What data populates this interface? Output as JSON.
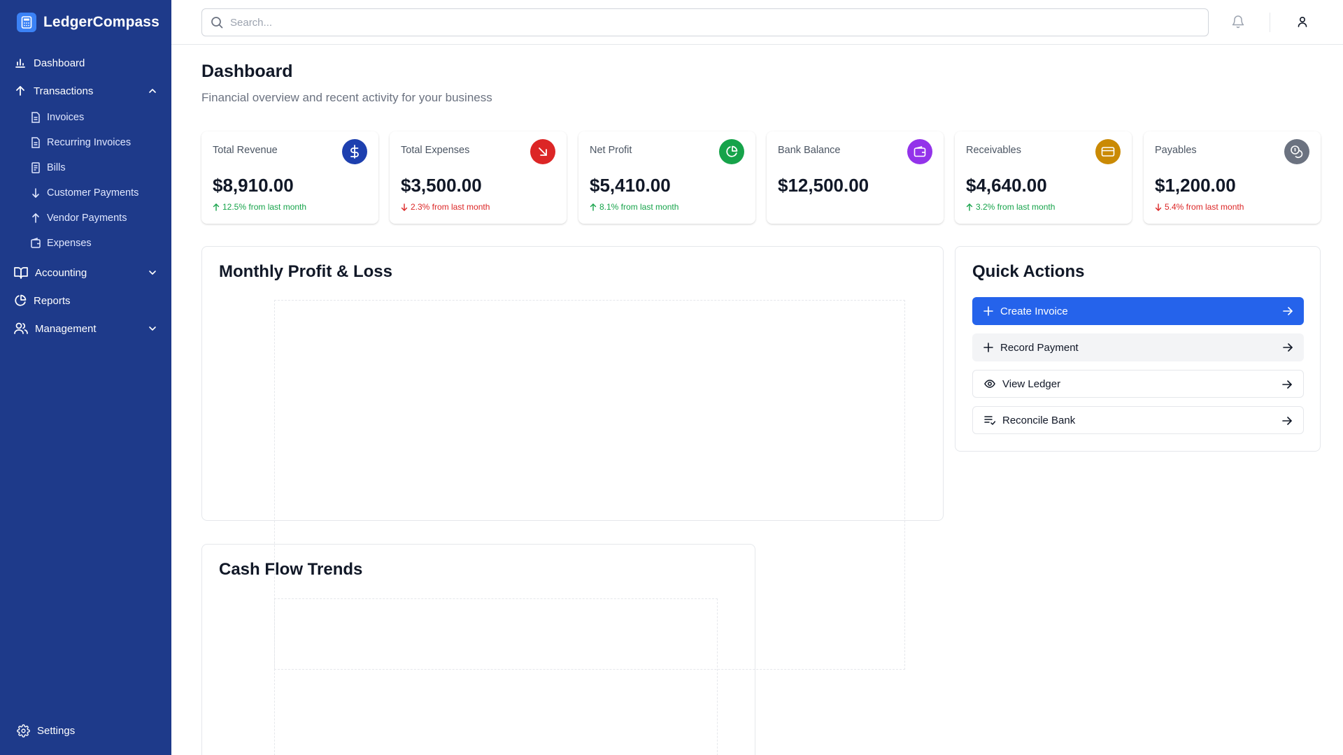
{
  "app": {
    "name": "LedgerCompass"
  },
  "sidebar": {
    "items": [
      {
        "label": "Dashboard",
        "icon": "bar-chart-icon"
      },
      {
        "label": "Transactions",
        "icon": "arrow-up-icon",
        "expanded": true
      },
      {
        "label": "Accounting",
        "icon": "book-icon",
        "expanded": false
      },
      {
        "label": "Reports",
        "icon": "pie-chart-icon"
      },
      {
        "label": "Management",
        "icon": "users-icon",
        "expanded": false
      }
    ],
    "transactions_sub": [
      {
        "label": "Invoices",
        "icon": "file-icon"
      },
      {
        "label": "Recurring Invoices",
        "icon": "file-icon"
      },
      {
        "label": "Bills",
        "icon": "receipt-icon"
      },
      {
        "label": "Customer Payments",
        "icon": "arrow-down-icon"
      },
      {
        "label": "Vendor Payments",
        "icon": "arrow-up-icon"
      },
      {
        "label": "Expenses",
        "icon": "wallet-icon"
      }
    ],
    "settings_label": "Settings"
  },
  "topbar": {
    "search_placeholder": "Search..."
  },
  "page": {
    "title": "Dashboard",
    "subtitle": "Financial overview and recent activity for your business"
  },
  "cards": [
    {
      "label": "Total Revenue",
      "value": "$8,910.00",
      "change": "12.5% from last month",
      "trend": "up",
      "icon": "dollar-icon",
      "color": "#1e40af"
    },
    {
      "label": "Total Expenses",
      "value": "$3,500.00",
      "change": "2.3% from last month",
      "trend": "down",
      "icon": "arrow-down-right-icon",
      "color": "#dc2626"
    },
    {
      "label": "Net Profit",
      "value": "$5,410.00",
      "change": "8.1% from last month",
      "trend": "up",
      "icon": "pie-chart-icon",
      "color": "#16a34a"
    },
    {
      "label": "Bank Balance",
      "value": "$12,500.00",
      "change": "",
      "icon": "wallet-icon",
      "color": "#9333ea"
    },
    {
      "label": "Receivables",
      "value": "$4,640.00",
      "change": "3.2% from last month",
      "trend": "up",
      "icon": "credit-card-icon",
      "color": "#ca8a04"
    },
    {
      "label": "Payables",
      "value": "$1,200.00",
      "change": "5.4% from last month",
      "trend": "down",
      "icon": "coins-icon",
      "color": "#6b7280"
    }
  ],
  "panels": {
    "pl_title": "Monthly Profit & Loss",
    "cashflow_title": "Cash Flow Trends",
    "quick_actions_title": "Quick Actions"
  },
  "quick_actions": [
    {
      "label": "Create Invoice",
      "icon": "plus-icon"
    },
    {
      "label": "Record Payment",
      "icon": "plus-icon"
    },
    {
      "label": "View Ledger",
      "icon": "eye-icon"
    },
    {
      "label": "Reconcile Bank",
      "icon": "list-check-icon"
    }
  ]
}
